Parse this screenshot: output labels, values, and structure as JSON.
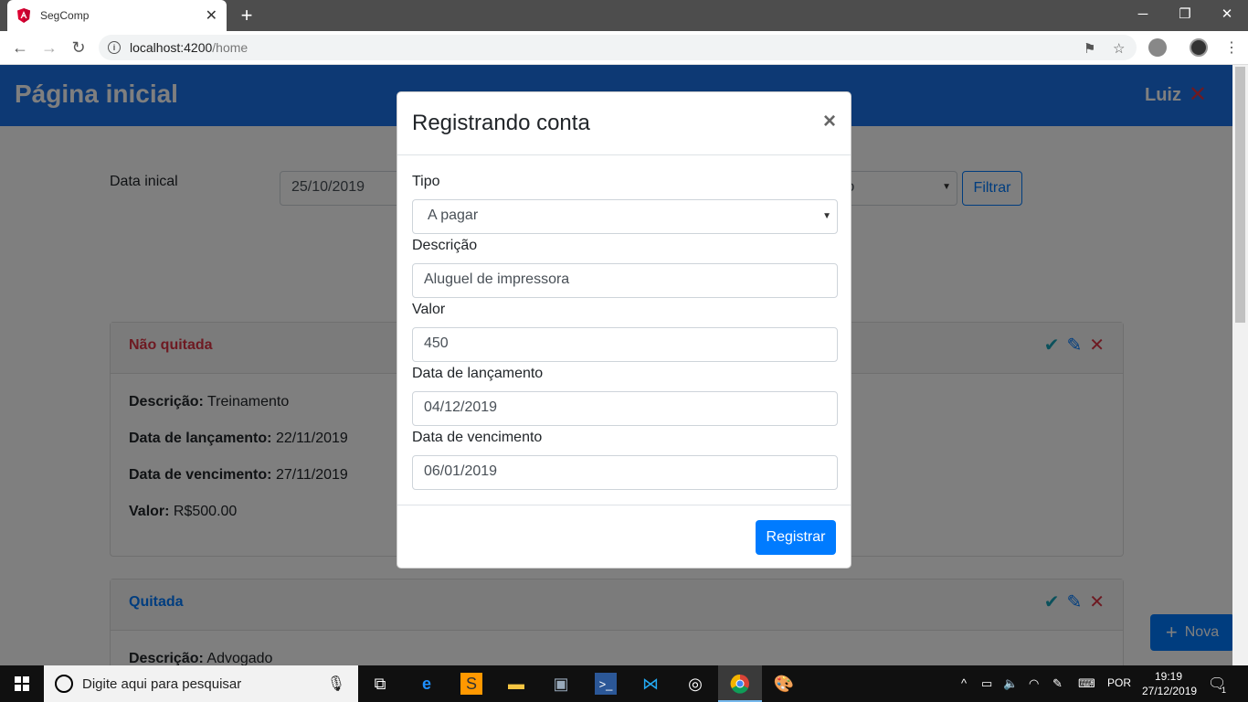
{
  "browser": {
    "tab_title": "SegComp",
    "url_host": "localhost:4200",
    "url_path": "/home"
  },
  "header": {
    "title": "Página inicial",
    "user": "Luiz"
  },
  "filter": {
    "label": "Data inical",
    "date_value": "25/10/2019",
    "select_value": "nto",
    "button": "Filtrar"
  },
  "cards": [
    {
      "status": "Não quitada",
      "status_color": "#dc3545",
      "fields": [
        {
          "label": "Descrição:",
          "value": "Treinamento"
        },
        {
          "label": "Data de lançamento:",
          "value": "22/11/2019"
        },
        {
          "label": "Data de vencimento:",
          "value": "27/11/2019"
        },
        {
          "label": "Valor:",
          "value": "R$500.00"
        }
      ]
    },
    {
      "status": "Quitada",
      "status_color": "#007bff",
      "fields": [
        {
          "label": "Descrição:",
          "value": "Advogado"
        }
      ]
    }
  ],
  "fab": {
    "label": "Nova"
  },
  "modal": {
    "title": "Registrando conta",
    "close": "×",
    "fields": [
      {
        "label": "Tipo",
        "value": "A pagar",
        "type": "select"
      },
      {
        "label": "Descrição",
        "value": "Aluguel de impressora",
        "type": "text"
      },
      {
        "label": "Valor",
        "value": "450",
        "type": "text"
      },
      {
        "label": "Data de lançamento",
        "value": "04/12/2019",
        "type": "text"
      },
      {
        "label": "Data de vencimento",
        "value": "06/01/2019",
        "type": "text"
      }
    ],
    "submit": "Registrar"
  },
  "taskbar": {
    "search_placeholder": "Digite aqui para pesquisar",
    "language": "POR",
    "time": "19:19",
    "date": "27/12/2019",
    "notification_count": "1"
  },
  "colors": {
    "primary": "#007bff",
    "header": "#1b72e8",
    "danger": "#dc3545"
  }
}
